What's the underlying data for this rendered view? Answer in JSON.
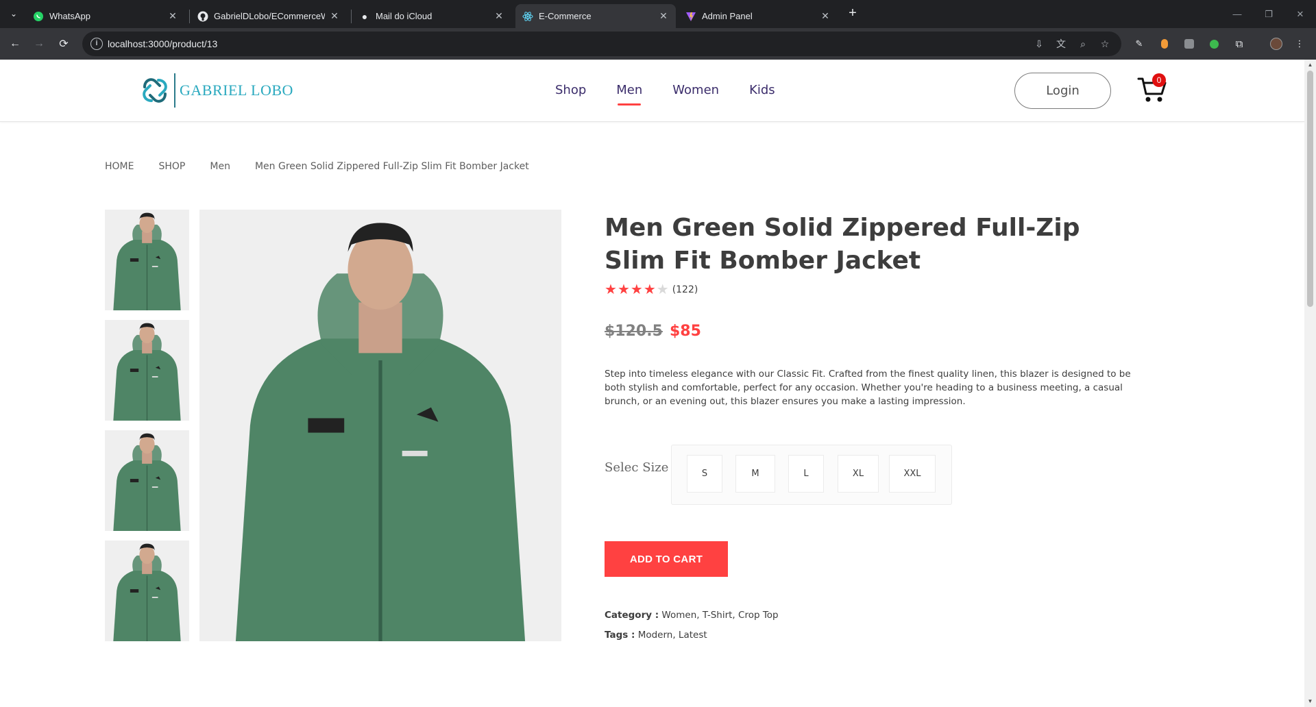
{
  "browser": {
    "tabs": [
      {
        "label": "WhatsApp",
        "icon": "whatsapp-icon",
        "active": false
      },
      {
        "label": "GabrielDLobo/ECommerceWith",
        "icon": "github-icon",
        "active": false
      },
      {
        "label": "Mail do iCloud",
        "icon": "apple-icon",
        "active": false
      },
      {
        "label": "E-Commerce",
        "icon": "react-icon",
        "active": true
      },
      {
        "label": "Admin Panel",
        "icon": "vite-icon",
        "active": false
      }
    ],
    "url": "localhost:3000/product/13"
  },
  "header": {
    "logo_text": "GABRIEL LOBO",
    "menu": [
      "Shop",
      "Men",
      "Women",
      "Kids"
    ],
    "active_menu": "Men",
    "login_label": "Login",
    "cart_count": "0"
  },
  "breadcrumb": [
    "HOME",
    "SHOP",
    "Men",
    "Men Green Solid Zippered Full-Zip Slim Fit Bomber Jacket"
  ],
  "product": {
    "title": "Men Green Solid Zippered Full-Zip Slim Fit Bomber Jacket",
    "rating_stars": 4,
    "rating_max": 5,
    "rating_count": "(122)",
    "old_price": "$120.5",
    "new_price": "$85",
    "description": "Step into timeless elegance with our Classic Fit. Crafted from the finest quality linen, this blazer is designed to be both stylish and comfortable, perfect for any occasion. Whether you're heading to a business meeting, a casual brunch, or an evening out, this blazer ensures you make a lasting impression.",
    "size_label": "Selec Size",
    "sizes": [
      "S",
      "M",
      "L",
      "XL",
      "XXL"
    ],
    "add_to_cart": "ADD TO CART",
    "category_label": "Category :",
    "category_value": "Women, T-Shirt, Crop Top",
    "tags_label": "Tags :",
    "tags_value": "Modern, Latest"
  },
  "colors": {
    "accent": "#ff4141",
    "menu_text": "#3b2d6b",
    "jacket_green": "#4f8566",
    "logo_teal": "#2aa9bf"
  }
}
